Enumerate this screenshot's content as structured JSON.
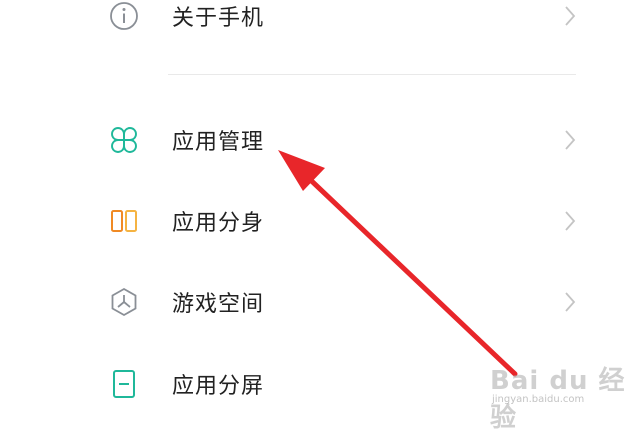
{
  "settings_list": {
    "items": [
      {
        "label": "关于手机",
        "icon": "info-icon",
        "color": "#8a8f96"
      },
      {
        "label": "应用管理",
        "icon": "app-management-icon",
        "color": "#1fb89a"
      },
      {
        "label": "应用分身",
        "icon": "app-clone-icon",
        "color": "#f08a24"
      },
      {
        "label": "游戏空间",
        "icon": "game-space-icon",
        "color": "#8a8f96"
      },
      {
        "label": "应用分屏",
        "icon": "split-screen-icon",
        "color": "#1fb89a"
      }
    ]
  },
  "annotation": {
    "arrow_color": "#e8262a"
  },
  "watermark": {
    "text": "Bai du 经验",
    "sub": "jingyan.baidu.com"
  }
}
